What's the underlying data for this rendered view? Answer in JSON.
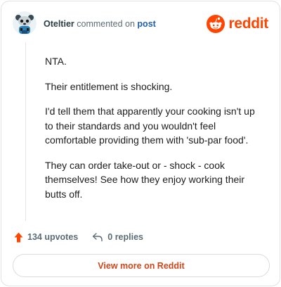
{
  "header": {
    "username": "Oteltier",
    "commented_text": "commented on",
    "post_link": "post",
    "brand": "reddit"
  },
  "comment": {
    "paragraphs": [
      "NTA.",
      "Their entitlement is shocking.",
      "I'd tell them that apparently your cooking isn't up to their standards and you wouldn't feel comfortable providing them with 'sub-par food'.",
      "They can order take-out or - shock - cook themselves! See how they enjoy working their butts off."
    ]
  },
  "actions": {
    "upvotes": "134 upvotes",
    "replies": "0 replies"
  },
  "footer": {
    "view_more": "View more on Reddit"
  },
  "colors": {
    "brand": "#ff4500",
    "link": "#1f5fa8",
    "view_more": "#d0461a"
  },
  "icons": {
    "avatar": "snoo-avatar",
    "logo": "reddit-logo-icon",
    "upvote": "upvote-arrow-icon",
    "reply": "reply-arrow-icon"
  }
}
